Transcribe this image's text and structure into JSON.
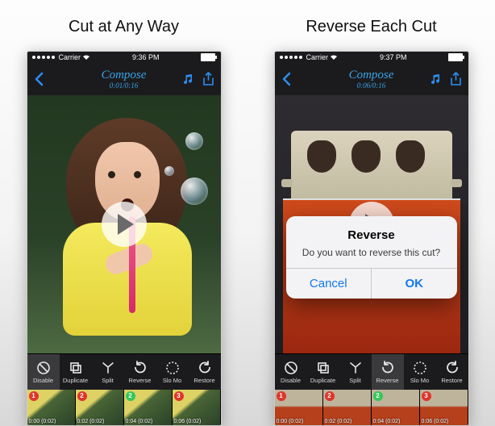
{
  "captions": {
    "left": "Cut at Any Way",
    "right": "Reverse Each Cut"
  },
  "status": {
    "carrier": "Carrier",
    "wifi": "wifi",
    "time_left": "9:36 PM",
    "time_right": "9:37 PM"
  },
  "nav": {
    "title": "Compose",
    "time_left": "0:01/0:16",
    "time_right": "0:06/0:16",
    "back_icon": "chevron-left-icon",
    "music_icon": "music-note-icon",
    "share_icon": "share-icon"
  },
  "alert": {
    "title": "Reverse",
    "message": "Do you want to reverse this cut?",
    "cancel": "Cancel",
    "ok": "OK"
  },
  "tools": [
    {
      "id": "disable",
      "label": "Disable"
    },
    {
      "id": "duplicate",
      "label": "Duplicate"
    },
    {
      "id": "split",
      "label": "Split"
    },
    {
      "id": "reverse",
      "label": "Reverse"
    },
    {
      "id": "slomo",
      "label": "Slo Mo"
    },
    {
      "id": "restore",
      "label": "Restore"
    }
  ],
  "strip": {
    "left": [
      {
        "n": "1",
        "dot": "red",
        "t1": "0:00",
        "t2": "(0:02)"
      },
      {
        "n": "2",
        "dot": "red",
        "t1": "0:02",
        "t2": "(0:02)"
      },
      {
        "n": "2",
        "dot": "green",
        "t1": "0:04",
        "t2": "(0:02)"
      },
      {
        "n": "3",
        "dot": "red",
        "t1": "0:06",
        "t2": "(0:02)"
      }
    ],
    "right": [
      {
        "n": "1",
        "dot": "red",
        "t1": "0:00",
        "t2": "(0:02)"
      },
      {
        "n": "2",
        "dot": "red",
        "t1": "0:02",
        "t2": "(0:02)"
      },
      {
        "n": "2",
        "dot": "green",
        "t1": "0:04",
        "t2": "(0:02)"
      },
      {
        "n": "3",
        "dot": "red",
        "t1": "0:06",
        "t2": "(0:02)"
      }
    ]
  }
}
